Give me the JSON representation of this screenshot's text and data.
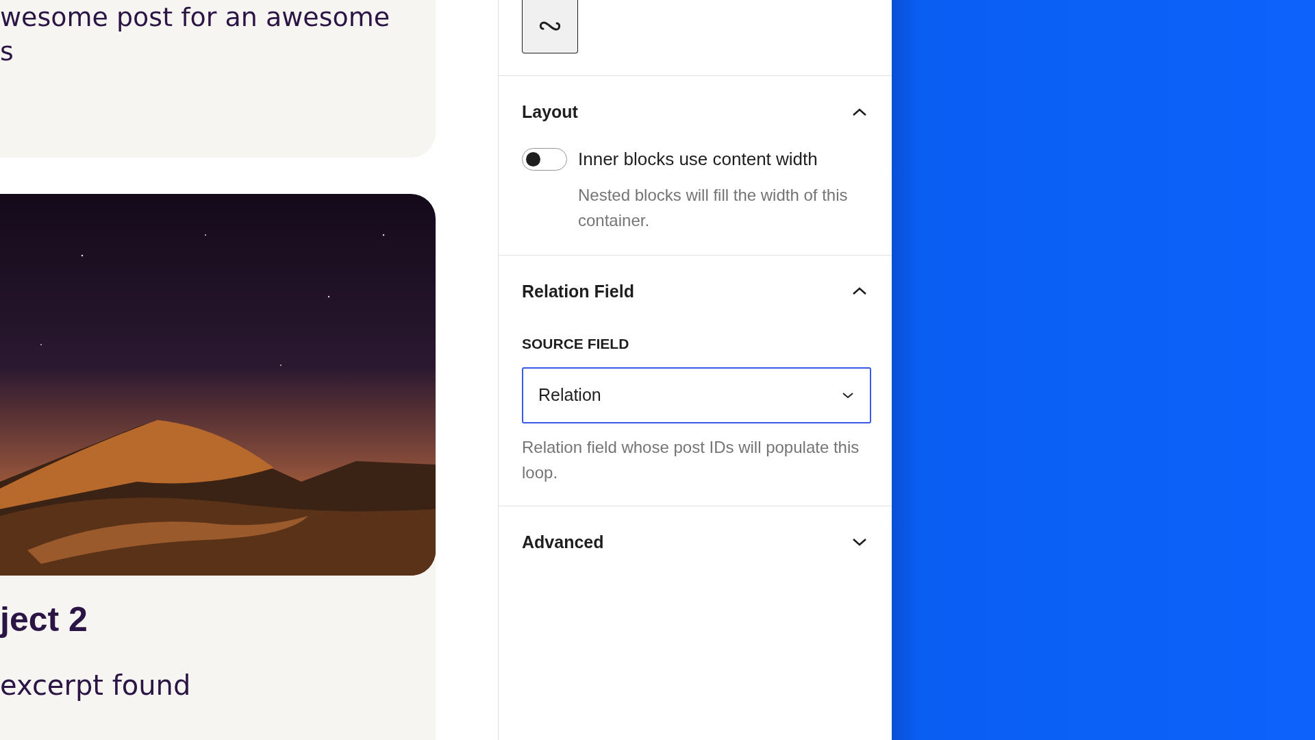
{
  "preview": {
    "first_post": {
      "title_lines": [
        "wesome post for an awesome",
        "s"
      ]
    },
    "second_post": {
      "title": "ject 2",
      "excerpt": "excerpt found"
    }
  },
  "sidebar": {
    "panels": [
      {
        "title": "Layout",
        "expanded": true,
        "kind": "toggle",
        "control": {
          "label": "Inner blocks use content width",
          "on": false,
          "help": "Nested blocks will fill the width of this container."
        }
      },
      {
        "title": "Relation Field",
        "expanded": true,
        "kind": "select",
        "control": {
          "label": "SOURCE FIELD",
          "value": "Relation",
          "help": "Relation field whose post IDs will populate this loop."
        }
      },
      {
        "title": "Advanced",
        "expanded": false
      }
    ]
  }
}
